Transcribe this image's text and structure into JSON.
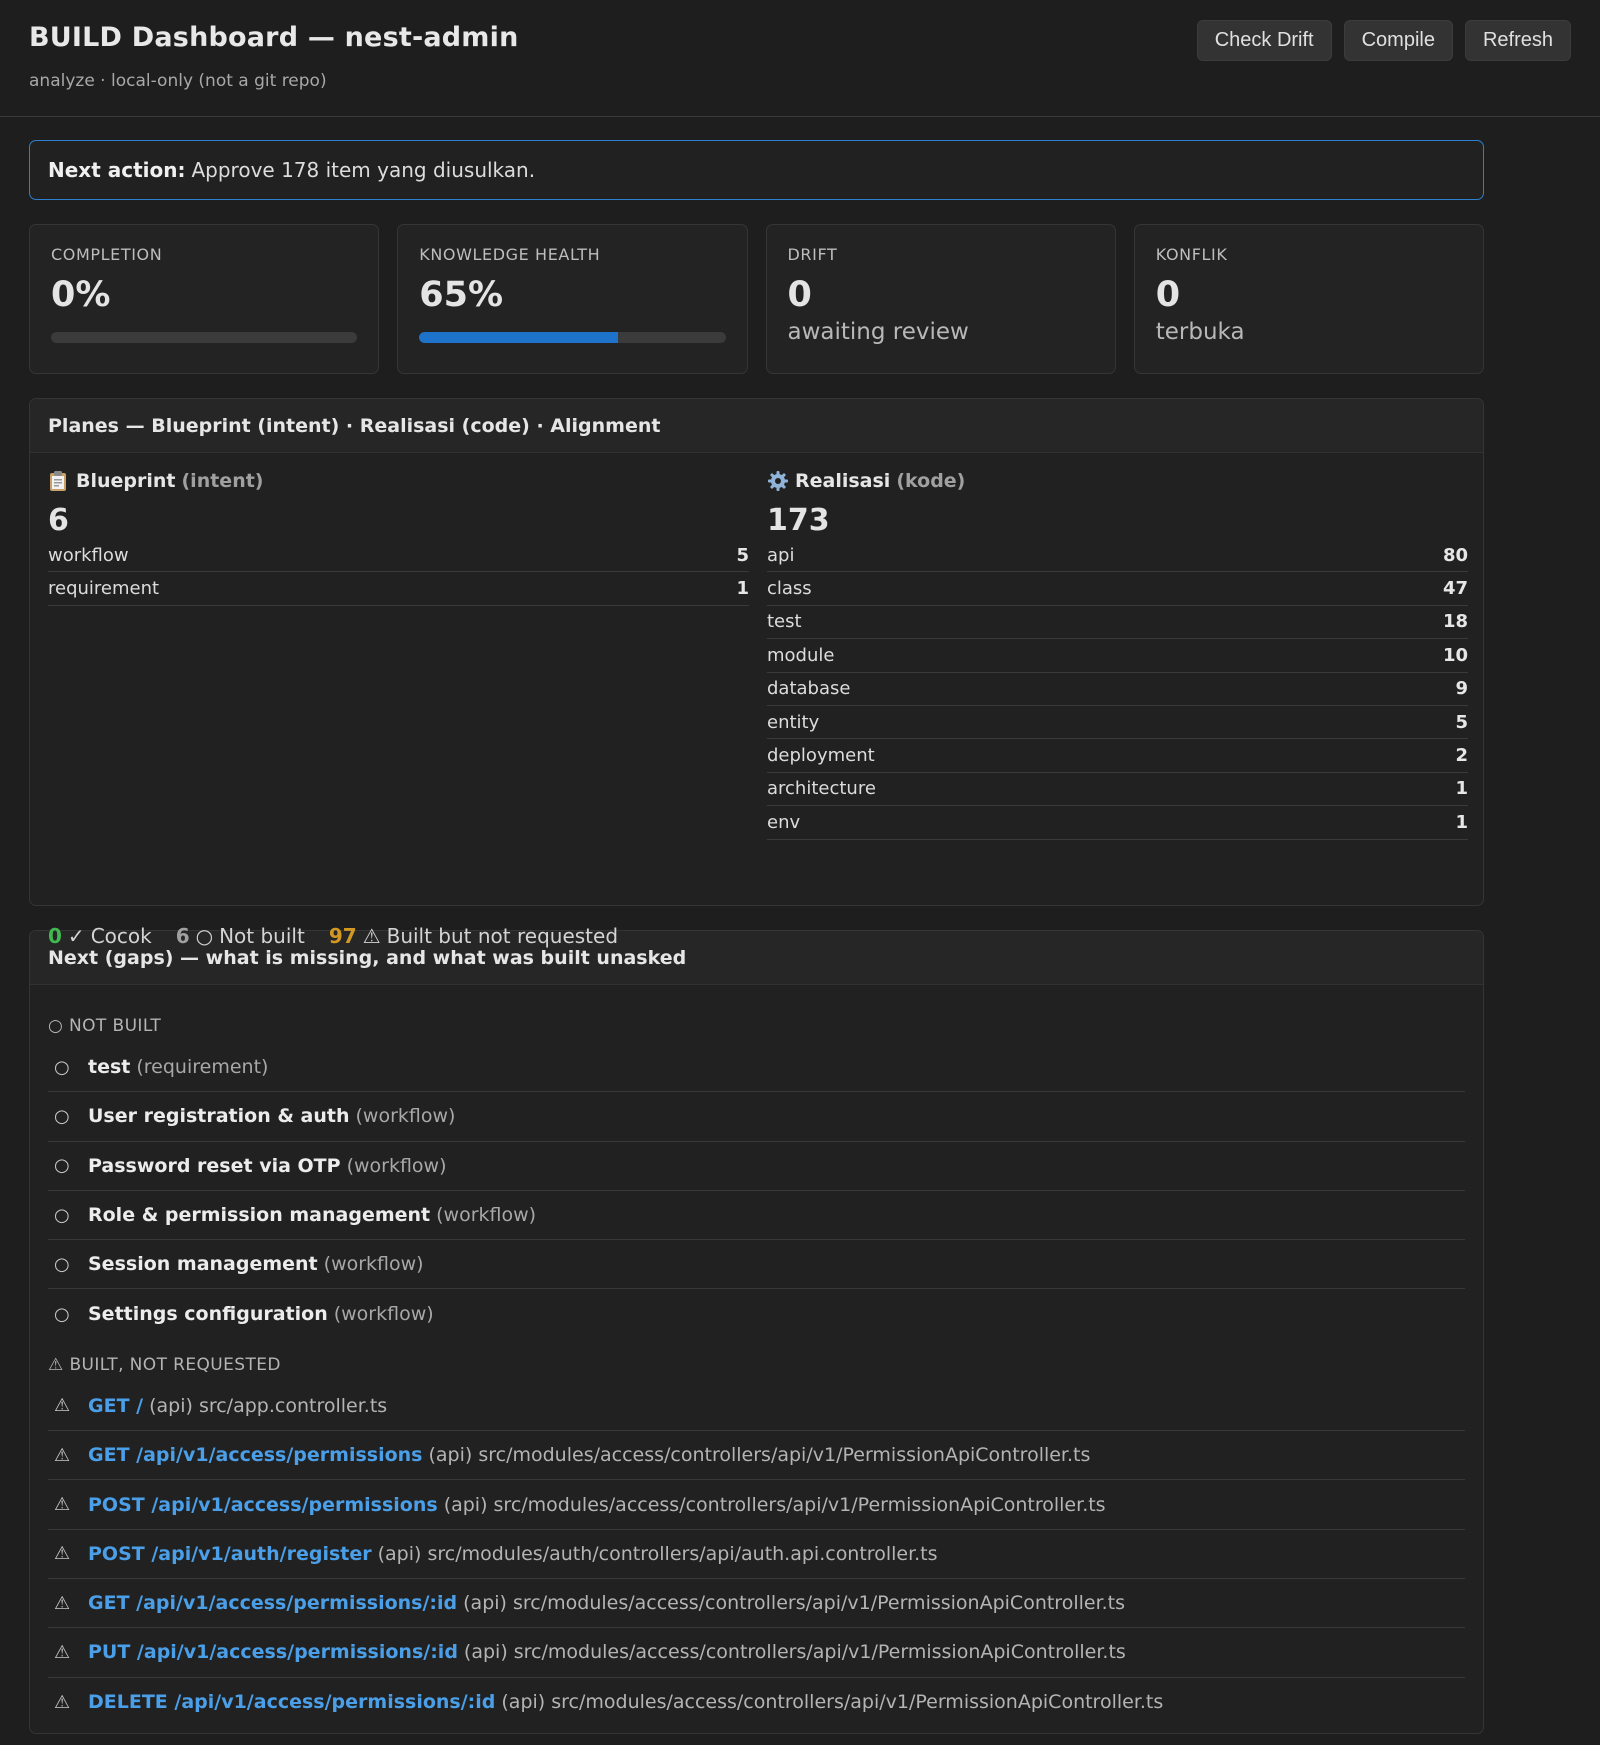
{
  "header": {
    "title": "BUILD Dashboard — nest-admin",
    "subtitle": "analyze · local-only (not a git repo)",
    "actions": [
      "Check Drift",
      "Compile",
      "Refresh"
    ]
  },
  "next_action": {
    "label": "Next action:",
    "text": "Approve 178 item yang diusulkan."
  },
  "cards": {
    "completion": {
      "label": "COMPLETION",
      "value": "0%",
      "progress": 0
    },
    "knowledge": {
      "label": "KNOWLEDGE HEALTH",
      "value": "65%",
      "progress": 65
    },
    "drift": {
      "label": "DRIFT",
      "value": "0",
      "sub": "awaiting review"
    },
    "konflik": {
      "label": "KONFLIK",
      "value": "0",
      "sub": "terbuka"
    }
  },
  "planes": {
    "title": "Planes — Blueprint (intent) · Realisasi (code) · Alignment",
    "blueprint": {
      "name": "Blueprint",
      "qualifier": "(intent)",
      "icon": "clipboard-icon",
      "total": "6",
      "items": [
        {
          "label": "workflow",
          "value": "5"
        },
        {
          "label": "requirement",
          "value": "1"
        }
      ]
    },
    "realisasi": {
      "name": "Realisasi",
      "qualifier": "(kode)",
      "icon": "gear-icon",
      "total": "173",
      "items": [
        {
          "label": "api",
          "value": "80"
        },
        {
          "label": "class",
          "value": "47"
        },
        {
          "label": "test",
          "value": "18"
        },
        {
          "label": "module",
          "value": "10"
        },
        {
          "label": "database",
          "value": "9"
        },
        {
          "label": "entity",
          "value": "5"
        },
        {
          "label": "deployment",
          "value": "2"
        },
        {
          "label": "architecture",
          "value": "1"
        },
        {
          "label": "env",
          "value": "1"
        }
      ]
    },
    "summary": [
      {
        "count": "0",
        "symbol": "✓",
        "label": "Cocok",
        "color": "#3fb950"
      },
      {
        "count": "6",
        "symbol": "○",
        "label": "Not built",
        "color": "#a0a0a0"
      },
      {
        "count": "97",
        "symbol": "⚠",
        "label": "Built but not requested",
        "color": "#d29922"
      }
    ]
  },
  "gaps": {
    "title": "Next (gaps) — what is missing, and what was built unasked",
    "not_built_label": "○ NOT BUILT",
    "not_built": [
      {
        "name": "test",
        "type": "(requirement)"
      },
      {
        "name": "User registration & auth",
        "type": "(workflow)"
      },
      {
        "name": "Password reset via OTP",
        "type": "(workflow)"
      },
      {
        "name": "Role & permission management",
        "type": "(workflow)"
      },
      {
        "name": "Session management",
        "type": "(workflow)"
      },
      {
        "name": "Settings configuration",
        "type": "(workflow)"
      }
    ],
    "built_label": "⚠ BUILT, NOT REQUESTED",
    "built": [
      {
        "name": "GET /",
        "meta": "(api) src/app.controller.ts"
      },
      {
        "name": "GET /api/v1/access/permissions",
        "meta": "(api) src/modules/access/controllers/api/v1/PermissionApiController.ts"
      },
      {
        "name": "POST /api/v1/access/permissions",
        "meta": "(api) src/modules/access/controllers/api/v1/PermissionApiController.ts"
      },
      {
        "name": "POST /api/v1/auth/register",
        "meta": "(api) src/modules/auth/controllers/api/auth.api.controller.ts"
      },
      {
        "name": "GET /api/v1/access/permissions/:id",
        "meta": "(api) src/modules/access/controllers/api/v1/PermissionApiController.ts"
      },
      {
        "name": "PUT /api/v1/access/permissions/:id",
        "meta": "(api) src/modules/access/controllers/api/v1/PermissionApiController.ts"
      },
      {
        "name": "DELETE /api/v1/access/permissions/:id",
        "meta": "(api) src/modules/access/controllers/api/v1/PermissionApiController.ts"
      }
    ]
  }
}
